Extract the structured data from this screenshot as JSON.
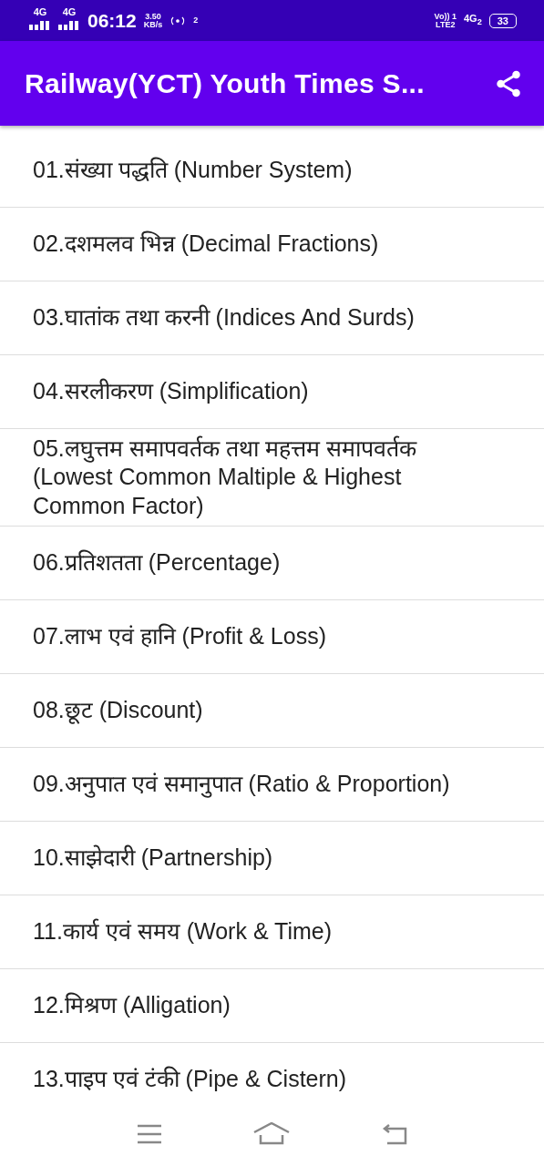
{
  "status_bar": {
    "left": [
      "4G",
      "4G"
    ],
    "time": "06:12",
    "speed_value": "3.50",
    "speed_unit": "KB/s",
    "hotspot": "2",
    "volte": "Vo))",
    "sim": "1",
    "lte": "LTE2",
    "network": "4G",
    "network_sim": "2",
    "battery": "33"
  },
  "app_bar": {
    "title": "Railway(YCT) Youth Times S..."
  },
  "items": [
    {
      "label": "01.संख्या पद्धति (Number System)"
    },
    {
      "label": "02.दशमलव भिन्न (Decimal Fractions)"
    },
    {
      "label": "03.घातांक तथा करनी (Indices And Surds)"
    },
    {
      "label": "04.सरलीकरण (Simplification)"
    },
    {
      "label": "05.लघुत्तम समापवर्तक तथा महत्तम समापवर्तक (Lowest Common Maltiple & Highest Common Factor)"
    },
    {
      "label": "06.प्रतिशतता (Percentage)"
    },
    {
      "label": "07.लाभ एवं हानि (Profit & Loss)"
    },
    {
      "label": "08.छूट (Discount)"
    },
    {
      "label": "09.अनुपात एवं समानुपात (Ratio & Proportion)"
    },
    {
      "label": "10.साझेदारी (Partnership)"
    },
    {
      "label": "11.कार्य एवं समय (Work & Time)"
    },
    {
      "label": "12.मिश्रण (Alligation)"
    },
    {
      "label": "13.पाइप एवं टंकी (Pipe & Cistern)"
    }
  ]
}
